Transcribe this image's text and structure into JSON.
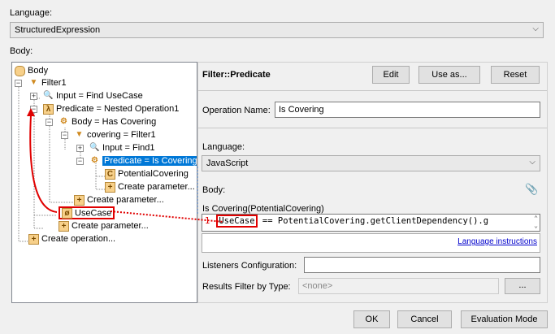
{
  "language_label": "Language:",
  "language_value": "StructuredExpression",
  "body_label": "Body:",
  "tree": {
    "root": "Body",
    "filter": "Filter1",
    "input": "Input = Find UseCase",
    "predicate": "Predicate = Nested Operation1",
    "body2": "Body = Has Covering",
    "covering": "covering = Filter1",
    "input2": "Input = Find1",
    "predicate2": "Predicate = Is Covering",
    "param": "PotentialCovering",
    "create_param_inner": "Create parameter...",
    "create_param_mid": "Create parameter...",
    "usecase": "UseCase",
    "create_param_outer": "Create parameter...",
    "create_op": "Create operation..."
  },
  "panel": {
    "title": "Filter::Predicate",
    "edit": "Edit",
    "use_as": "Use as...",
    "reset": "Reset",
    "op_name_label": "Operation Name:",
    "op_name_value": "Is Covering",
    "lang_label": "Language:",
    "lang_value": "JavaScript",
    "body_label": "Body:",
    "signature": "Is Covering(PotentialCovering)",
    "line_no": "1",
    "code_highlight": "UseCase",
    "code_rest": " == PotentialCovering.getClientDependency().g",
    "lang_instructions": "Language instructions",
    "listeners_label": "Listeners Configuration:",
    "listeners_value": "",
    "results_label": "Results Filter by Type:",
    "results_value": "<none>",
    "browse": "..."
  },
  "footer": {
    "ok": "OK",
    "cancel": "Cancel",
    "eval": "Evaluation Mode"
  },
  "colors": {
    "accent": "#0078d7",
    "annotation": "#e00000"
  }
}
